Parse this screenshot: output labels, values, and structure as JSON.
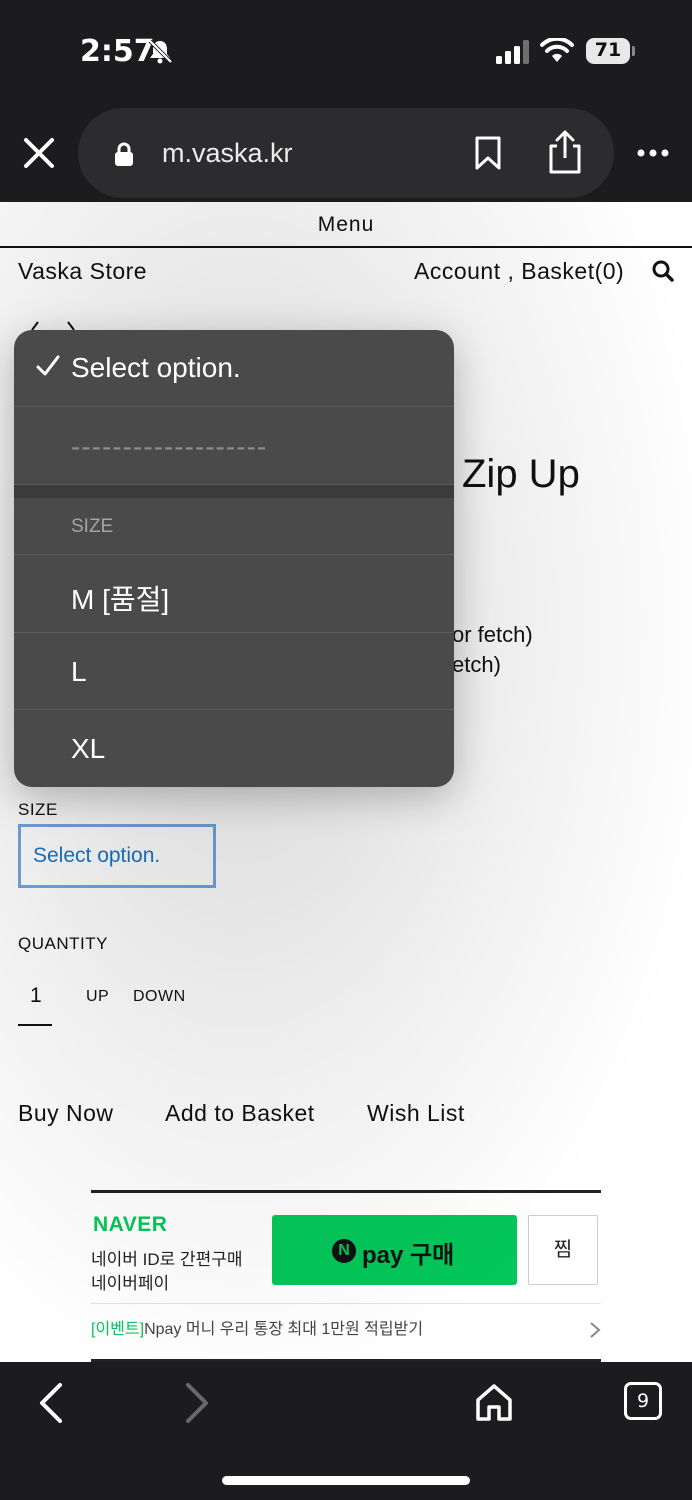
{
  "status_bar": {
    "time": "2:57",
    "battery": "71",
    "icons": [
      "bell-slash-icon",
      "signal-icon",
      "wifi-icon",
      "battery-icon"
    ]
  },
  "browser": {
    "url": "m.vaska.kr",
    "icons": [
      "close-icon",
      "lock-icon",
      "bookmark-icon",
      "share-icon",
      "more-icon"
    ]
  },
  "site": {
    "menu_label": "Menu",
    "store_name": "Vaska Store",
    "account_basket": "Account , Basket(0)"
  },
  "product": {
    "title_partial": "Zip Up",
    "desc_line1": "or fetch)",
    "desc_line2": "etch)"
  },
  "options": {
    "size_label": "SIZE",
    "select_value": "Select option."
  },
  "popup": {
    "selected": "Select option.",
    "divider": "-------------------",
    "group_label": "SIZE",
    "items": [
      "M [품절]",
      "L",
      "XL"
    ]
  },
  "quantity": {
    "label": "QUANTITY",
    "value": "1",
    "up": "UP",
    "down": "DOWN"
  },
  "actions": {
    "buy_now": "Buy Now",
    "add_to_basket": "Add to Basket",
    "wish_list": "Wish List"
  },
  "naver_pay": {
    "logo": "NAVER",
    "line1": "네이버 ID로 간편구매",
    "line2": "네이버페이",
    "n_badge": "N",
    "pay_button": "pay 구매",
    "zzim": "찜",
    "event_tag": "[이벤트]",
    "event_text": "Npay 머니 우리 통장 최대 1만원 적립받기",
    "brand_color": "#03c75a"
  },
  "toolbar": {
    "tab_count": "9",
    "icons": [
      "back-icon",
      "forward-icon",
      "home-icon",
      "tabs-icon"
    ]
  }
}
